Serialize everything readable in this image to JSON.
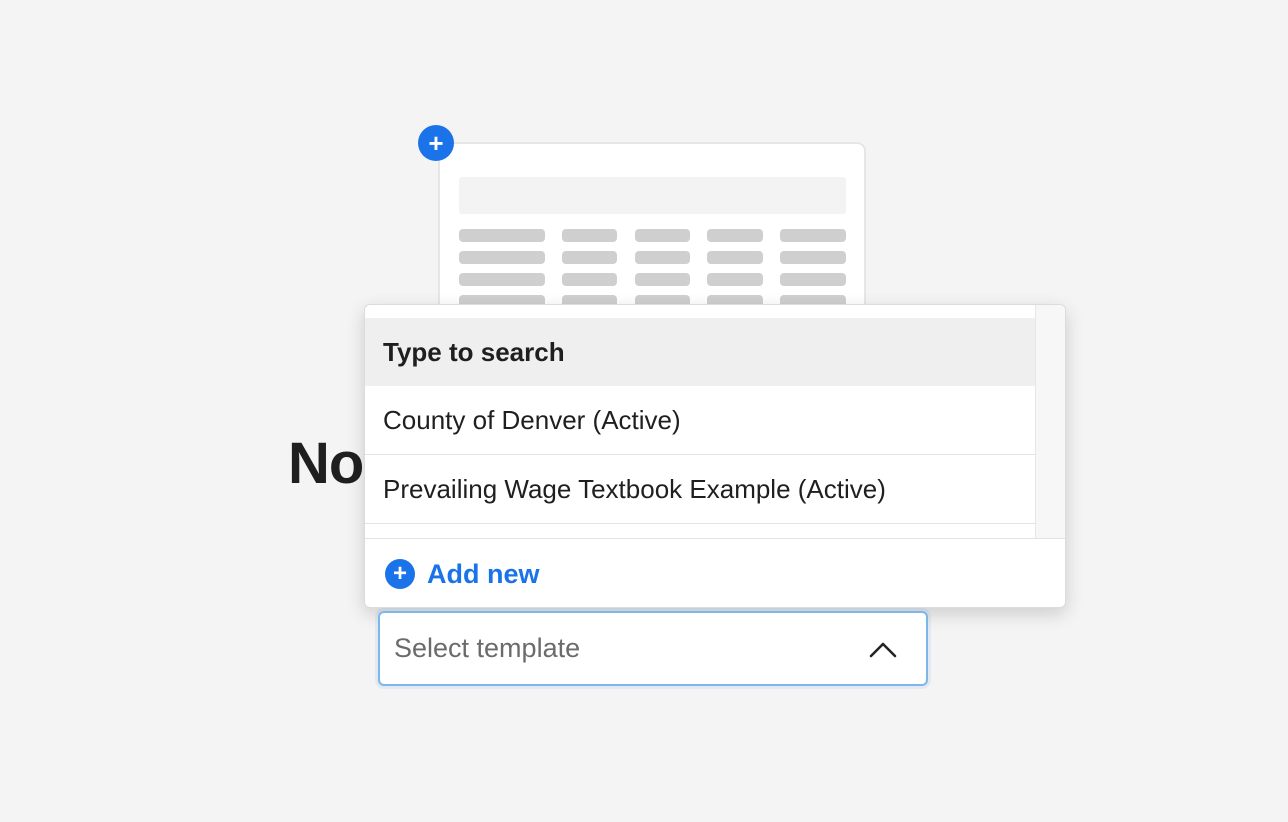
{
  "empty_state": {
    "heading": "No",
    "plus_badge_symbol": "+"
  },
  "dropdown": {
    "search_placeholder": "Type to search",
    "items": [
      {
        "label": "County of Denver (Active)"
      },
      {
        "label": "Prevailing Wage Textbook Example (Active)"
      }
    ],
    "add_new": {
      "icon": "plus-circle-icon",
      "symbol": "+",
      "label": "Add new"
    }
  },
  "select": {
    "placeholder": "Select template",
    "icon": "chevron-up-icon"
  },
  "colors": {
    "accent": "#1a73e8",
    "background": "#f4f4f4"
  }
}
